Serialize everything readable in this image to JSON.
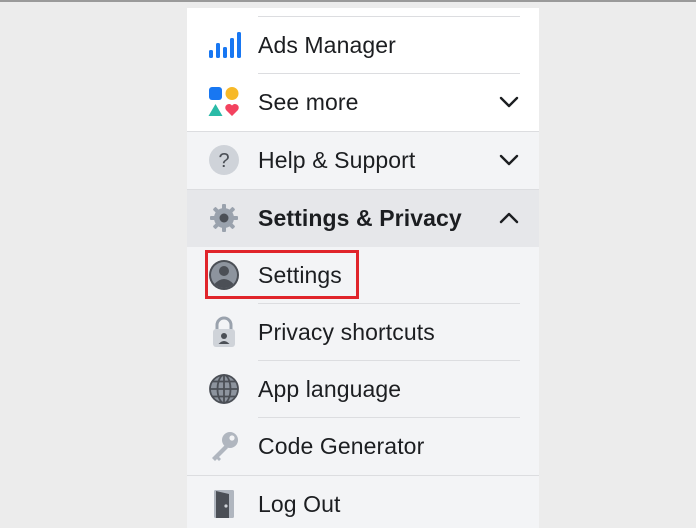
{
  "menu": {
    "items": [
      {
        "label": "Ads Manager",
        "icon": "bar-chart-icon"
      },
      {
        "label": "See more",
        "icon": "shapes-icon",
        "chevron": "down"
      },
      {
        "label": "Help & Support",
        "icon": "question-icon",
        "chevron": "down"
      },
      {
        "label": "Settings & Privacy",
        "icon": "gear-icon",
        "chevron": "up"
      },
      {
        "label": "Settings",
        "icon": "account-circle-icon"
      },
      {
        "label": "Privacy shortcuts",
        "icon": "lock-icon"
      },
      {
        "label": "App language",
        "icon": "globe-icon"
      },
      {
        "label": "Code Generator",
        "icon": "key-icon"
      },
      {
        "label": "Log Out",
        "icon": "door-icon"
      }
    ]
  },
  "colors": {
    "highlight_border": "#e0242b",
    "panel_bg": "#ffffff",
    "section_bg": "#f3f4f6",
    "active_bg": "#e6e7ea",
    "text": "#1c1e21",
    "ads_blue": "#1877f2"
  }
}
